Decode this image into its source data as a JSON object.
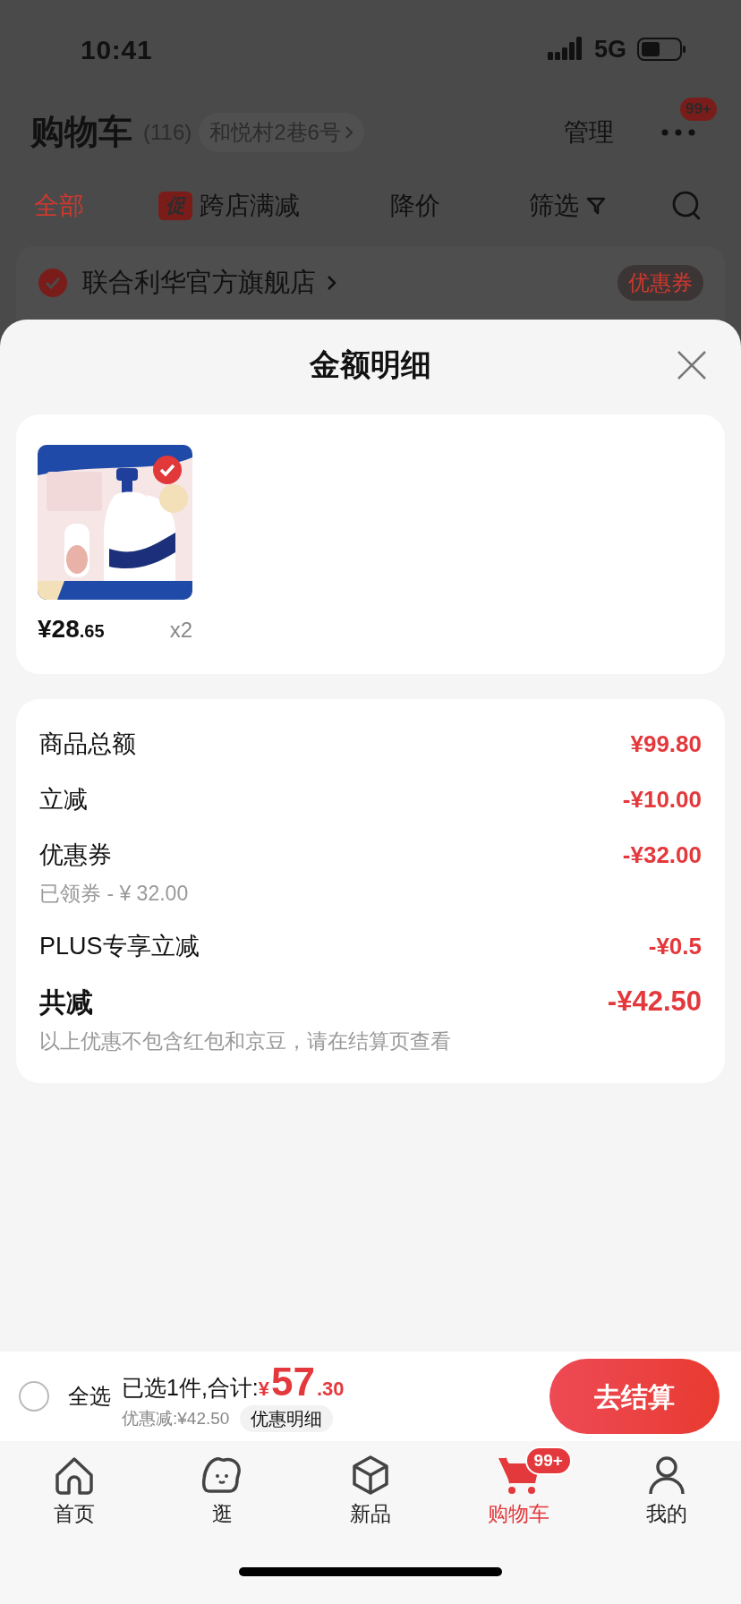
{
  "status_bar": {
    "time": "10:41",
    "network": "5G"
  },
  "header": {
    "title": "购物车",
    "count": "(116)",
    "address": "和悦村2巷6号",
    "manage": "管理",
    "more_badge": "99+"
  },
  "filter_tabs": [
    {
      "label": "全部",
      "selected": true
    },
    {
      "label": "跨店满减",
      "promo_tag": "促",
      "selected": false
    },
    {
      "label": "降价",
      "selected": false
    },
    {
      "label": "筛选",
      "selected": false
    }
  ],
  "store": {
    "name": "联合利华官方旗舰店",
    "checked": true,
    "coupon": "优惠券"
  },
  "sheet": {
    "title": "金额明细",
    "product": {
      "kind": "picture",
      "checked": true,
      "price_main": "¥28",
      "price_decimal": ".65",
      "quantity": "x2"
    },
    "rows": [
      {
        "kind": "normal",
        "label": "商品总额",
        "amount": "¥99.80"
      },
      {
        "kind": "normal",
        "label": "立减",
        "amount": "-¥10.00"
      },
      {
        "kind": "normal",
        "label": "优惠券",
        "amount": "-¥32.00",
        "note": "已领券 - ¥ 32.00"
      },
      {
        "kind": "normal",
        "label": "PLUS专享立减",
        "amount": "-¥0.5"
      },
      {
        "kind": "total",
        "label": "共减",
        "amount": "-¥42.50",
        "note": "以上优惠不包含红包和京豆，请在结算页查看"
      }
    ]
  },
  "footer": {
    "select_all": {
      "label": "全选",
      "checked": false
    },
    "summary": "已选1件,合计:",
    "currency": "¥",
    "total_main": "57",
    "total_decimal": ".30",
    "discount": "优惠减:¥42.50",
    "detail_button": "优惠明细",
    "checkout": "去结算"
  },
  "nav": [
    {
      "label": "首页",
      "kind": "home",
      "selected": false
    },
    {
      "label": "逛",
      "kind": "blob",
      "selected": false
    },
    {
      "label": "新品",
      "kind": "cube",
      "selected": false
    },
    {
      "label": "购物车",
      "kind": "cart",
      "selected": true,
      "badge": "99+"
    },
    {
      "label": "我的",
      "kind": "person",
      "selected": false
    }
  ]
}
